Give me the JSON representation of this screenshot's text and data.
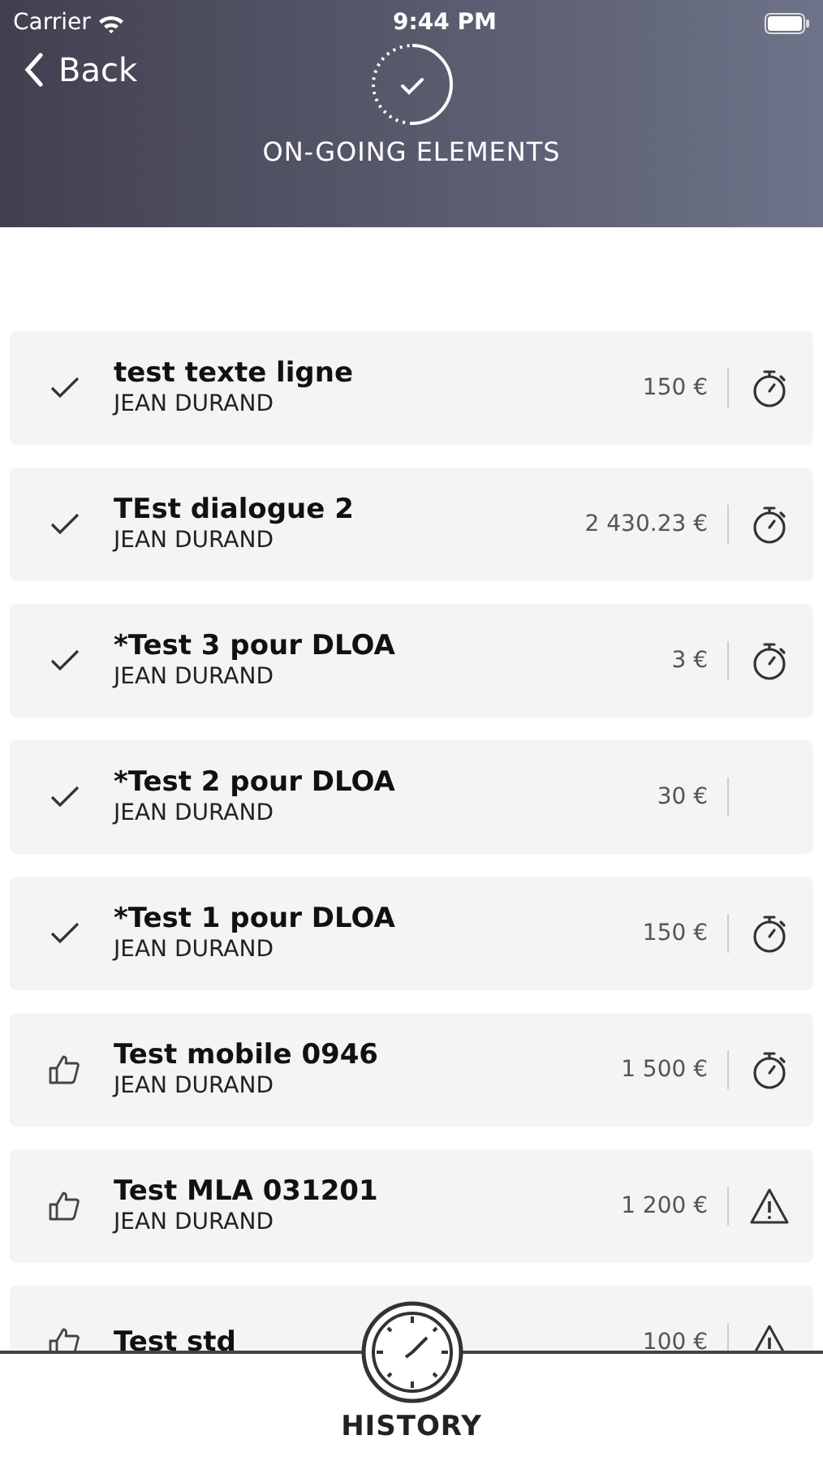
{
  "status_bar": {
    "carrier": "Carrier",
    "time": "9:44 PM"
  },
  "nav": {
    "back": "Back",
    "title": "ON-GOING ELEMENTS"
  },
  "items": [
    {
      "kind": "check",
      "title": "test texte ligne",
      "person": "JEAN DURAND",
      "amount": "150 €",
      "timer": true,
      "warning": false
    },
    {
      "kind": "check",
      "title": "TEst dialogue 2",
      "person": "JEAN DURAND",
      "amount": "2 430.23 €",
      "timer": true,
      "warning": false
    },
    {
      "kind": "check",
      "title": "*Test 3 pour DLOA",
      "person": "JEAN DURAND",
      "amount": "3 €",
      "timer": true,
      "warning": false
    },
    {
      "kind": "check",
      "title": "*Test 2 pour DLOA",
      "person": "JEAN DURAND",
      "amount": "30 €",
      "timer": false,
      "warning": false
    },
    {
      "kind": "check",
      "title": "*Test 1 pour DLOA",
      "person": "JEAN DURAND",
      "amount": "150 €",
      "timer": true,
      "warning": false
    },
    {
      "kind": "thumb",
      "title": "Test mobile 0946",
      "person": "JEAN DURAND",
      "amount": "1 500 €",
      "timer": true,
      "warning": false
    },
    {
      "kind": "thumb",
      "title": "Test MLA 031201",
      "person": "JEAN DURAND",
      "amount": "1 200 €",
      "timer": false,
      "warning": true
    },
    {
      "kind": "thumb",
      "title": "Test std",
      "amount": "100 €",
      "timer": false,
      "warning": true
    }
  ],
  "bottom_tab": {
    "label": "HISTORY"
  }
}
